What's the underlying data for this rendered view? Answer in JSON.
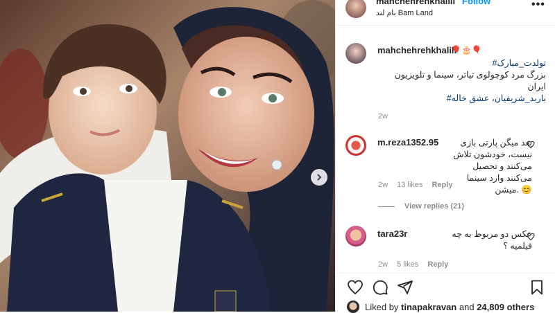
{
  "header": {
    "username": "mahchehrehkhalili",
    "follow_label": "Follow",
    "location": "بام لند Bam Land",
    "more_icon": "more-horizontal-icon"
  },
  "post": {
    "username": "mahchehrehkhalili",
    "emoji": "🎈🎂🎈",
    "caption_line1": "#تولدت_مبارک",
    "caption_line2": "بزرگ مرد کوچولوی تیاتر، سینما و تلویزیون",
    "caption_line3": "ایران",
    "caption_line4": "#باربد_شریفیان، عشق خاله",
    "time": "2w"
  },
  "comments": [
    {
      "username": "m.reza1352.95",
      "text": "بعد میگن پارتی بازی نیست، خودشون تلاش می‌کنند و تحصیل می‌کنند وارد سینما میشن. 😊",
      "time": "2w",
      "likes": "13 likes",
      "reply": "Reply"
    },
    {
      "username": "tara23r",
      "text": "عکس دو مربوط به چه فیلمیه ؟",
      "time": "2w",
      "likes": "5 likes",
      "reply": "Reply"
    }
  ],
  "view_replies": "View replies (21)",
  "footer": {
    "liked_by_prefix": "Liked by",
    "liked_by_user": "tinapakravan",
    "liked_and": "and",
    "liked_others": "24,809 others"
  },
  "colors": {
    "link_blue": "#0095f6",
    "hashtag": "#00376b",
    "muted": "#8e8e8e",
    "border": "#efefef"
  }
}
